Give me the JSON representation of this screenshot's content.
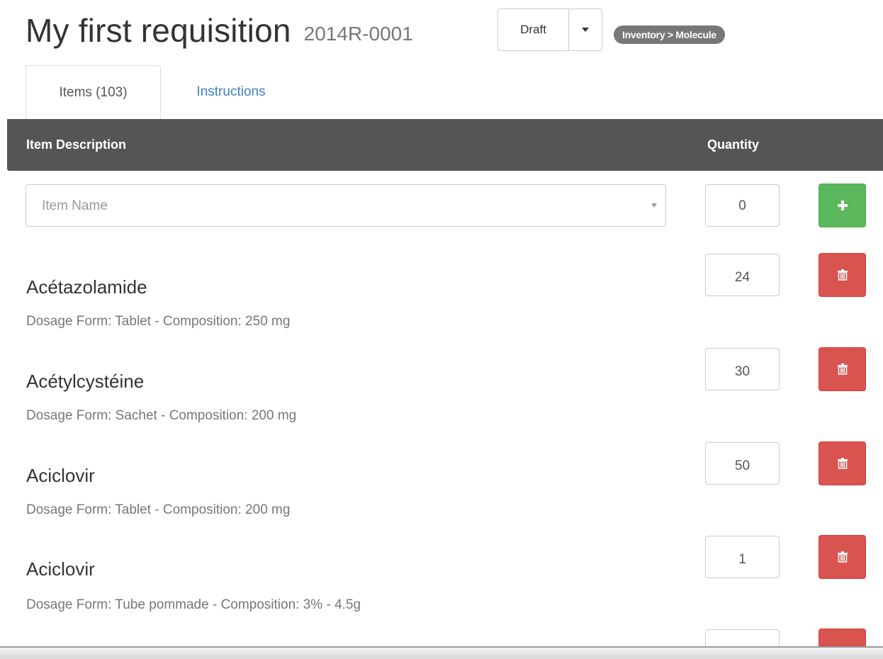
{
  "page": {
    "title": "My first requisition",
    "requisition_id": "2014R-0001",
    "status": "Draft",
    "badge": "Inventory > Molecule"
  },
  "tabs": [
    {
      "label": "Items (103)",
      "active": true
    },
    {
      "label": "Instructions",
      "active": false
    }
  ],
  "table": {
    "col_description": "Item Description",
    "col_quantity": "Quantity"
  },
  "new_item": {
    "placeholder": "Item Name",
    "quantity": "0"
  },
  "items": [
    {
      "name": "Acétazolamide",
      "meta": "Dosage Form: Tablet - Composition: 250 mg",
      "quantity": "24"
    },
    {
      "name": "Acétylcystéine",
      "meta": "Dosage Form: Sachet - Composition: 200 mg",
      "quantity": "30"
    },
    {
      "name": "Aciclovir",
      "meta": "Dosage Form: Tablet - Composition: 200 mg",
      "quantity": "50"
    },
    {
      "name": "Aciclovir",
      "meta": "Dosage Form: Tube pommade - Composition: 3% - 4.5g",
      "quantity": "1"
    }
  ],
  "colors": {
    "header_bg": "#555555",
    "add_button": "#5cb85c",
    "delete_button": "#d9534f",
    "badge_bg": "#777777",
    "link": "#3a80c8"
  },
  "icons": {
    "add": "plus-icon",
    "delete": "trash-icon",
    "status_toggle": "caret-down-icon",
    "select_toggle": "chevron-down-icon"
  }
}
